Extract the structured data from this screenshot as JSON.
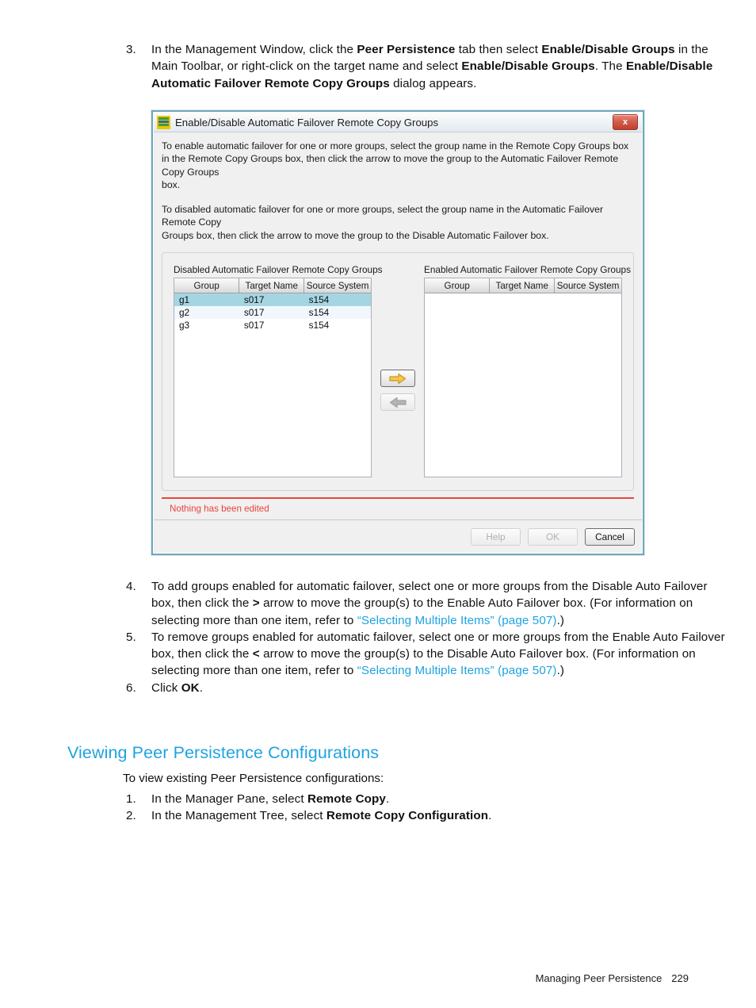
{
  "document": {
    "steps_top": [
      {
        "num": "3.",
        "parts": [
          {
            "t": "In the Management Window, click the ",
            "s": "n"
          },
          {
            "t": "Peer Persistence",
            "s": "b"
          },
          {
            "t": " tab then select ",
            "s": "n"
          },
          {
            "t": "Enable/Disable Groups",
            "s": "b"
          },
          {
            "t": " in the Main Toolbar, or right-click on the target name and select ",
            "s": "n"
          },
          {
            "t": "Enable/Disable Groups",
            "s": "b"
          },
          {
            "t": ". The ",
            "s": "n"
          },
          {
            "t": "Enable/Disable Automatic Failover Remote Copy Groups",
            "s": "b"
          },
          {
            "t": " dialog appears.",
            "s": "n"
          }
        ]
      }
    ],
    "steps_bottom": [
      {
        "num": "4.",
        "parts": [
          {
            "t": "To add groups enabled for automatic failover, select one or more groups from the Disable Auto Failover box, then click the ",
            "s": "n"
          },
          {
            "t": ">",
            "s": "b"
          },
          {
            "t": " arrow to move the group(s) to the Enable Auto Failover box. (For information on selecting more than one item, refer to ",
            "s": "n"
          },
          {
            "t": "“Selecting Multiple Items” (page 507)",
            "s": "l"
          },
          {
            "t": ".)",
            "s": "n"
          }
        ]
      },
      {
        "num": "5.",
        "parts": [
          {
            "t": "To remove groups enabled for automatic failover, select one or more groups from the Enable Auto Failover box, then click the ",
            "s": "n"
          },
          {
            "t": "<",
            "s": "b"
          },
          {
            "t": " arrow to move the group(s) to the Disable Auto Failover box. (For information on selecting more than one item, refer to ",
            "s": "n"
          },
          {
            "t": "“Selecting Multiple Items” (page 507)",
            "s": "l"
          },
          {
            "t": ".)",
            "s": "n"
          }
        ]
      },
      {
        "num": "6.",
        "parts": [
          {
            "t": "Click ",
            "s": "n"
          },
          {
            "t": "OK",
            "s": "b"
          },
          {
            "t": ".",
            "s": "n"
          }
        ]
      }
    ],
    "section_heading": "Viewing Peer Persistence Configurations",
    "section_intro": "To view existing Peer Persistence configurations:",
    "steps_section": [
      {
        "num": "1.",
        "parts": [
          {
            "t": "In the Manager Pane, select ",
            "s": "n"
          },
          {
            "t": "Remote Copy",
            "s": "b"
          },
          {
            "t": ".",
            "s": "n"
          }
        ]
      },
      {
        "num": "2.",
        "parts": [
          {
            "t": "In the Management Tree, select ",
            "s": "n"
          },
          {
            "t": "Remote Copy Configuration",
            "s": "b"
          },
          {
            "t": ".",
            "s": "n"
          }
        ]
      }
    ],
    "footer": {
      "chapter": "Managing Peer Persistence",
      "page_number": "229"
    }
  },
  "dialog": {
    "title": "Enable/Disable Automatic Failover Remote Copy Groups",
    "title_icon": "three-par-logo-icon",
    "close_label": "x",
    "intro": {
      "para1_line1": "To enable automatic failover for one or more groups, select the group name in the Remote Copy Groups box",
      "para1_line2": "in the Remote Copy Groups box, then click the arrow to move the group to the Automatic Failover Remote Copy Groups",
      "para1_line3": "box.",
      "para2_line1": "To disabled automatic failover for one or more groups, select the group name in the Automatic Failover Remote Copy",
      "para2_line2": "Groups box, then click the arrow to move the group to the Disable Automatic Failover box."
    },
    "left_list": {
      "caption": "Disabled Automatic Failover Remote Copy Groups",
      "columns": [
        "Group",
        "Target Name",
        "Source System"
      ],
      "rows": [
        {
          "group": "g1",
          "target_name": "s017",
          "source_system": "s154",
          "state": "selected"
        },
        {
          "group": "g2",
          "target_name": "s017",
          "source_system": "s154",
          "state": "alt"
        },
        {
          "group": "g3",
          "target_name": "s017",
          "source_system": "s154",
          "state": "normal"
        }
      ]
    },
    "right_list": {
      "caption": "Enabled Automatic Failover Remote Copy Groups",
      "columns": [
        "Group",
        "Target Name",
        "Source System"
      ],
      "rows": []
    },
    "arrows": {
      "move_right": {
        "icon": "arrow-right-icon",
        "enabled": true
      },
      "move_left": {
        "icon": "arrow-left-icon",
        "enabled": false
      }
    },
    "status_message": "Nothing has been edited",
    "buttons": {
      "help": "Help",
      "ok": "OK",
      "cancel": "Cancel"
    },
    "colors": {
      "status_text": "#e8443c",
      "selection": "#a6d5e2",
      "alt_row": "#f1f7fd",
      "frame": "#6fa8bd",
      "link": "#1fa3e0",
      "heading": "#1fa3e0"
    }
  }
}
